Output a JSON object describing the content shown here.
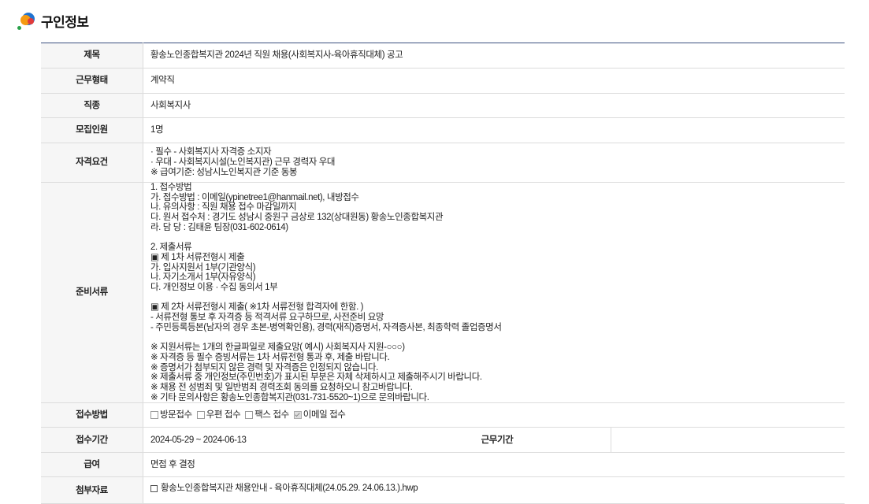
{
  "section": {
    "title": "구인정보"
  },
  "rows": {
    "title": {
      "label": "제목",
      "value": "황송노인종합복지관 2024년 직원 채용(사회복지사-육아휴직대체) 공고"
    },
    "work_type": {
      "label": "근무형태",
      "value": "계약직"
    },
    "job": {
      "label": "직종",
      "value": "사회복지사"
    },
    "headcount": {
      "label": "모집인원",
      "value": "1명"
    },
    "qualification": {
      "label": "자격요건",
      "value": "· 필수 - 사회복지사 자격증 소지자\n· 우대 - 사회복지시설(노인복지관) 근무 경력자 우대\n※ 급여기준: 성남시노인복지관 기준 동봉"
    },
    "documents": {
      "label": "준비서류",
      "value": "1. 접수방법\n가. 접수방법 : 이메일(ypinetree1@hanmail.net), 내방접수\n나. 유의사항 : 직원 채용 접수 마감일까지\n다. 원서 접수처 : 경기도 성남시 중원구 금상로 132(상대원동) 황송노인종합복지관\n라. 담   당 : 김태윤 팀장(031-602-0614)\n\n2. 제출서류\n▣ 제 1차 서류전형시 제출\n가. 입사지원서 1부(기관양식)\n나. 자기소개서 1부(자유양식)\n다. 개인정보 이용 · 수집 동의서 1부\n\n▣ 제 2차 서류전형시 제출( ※1차 서류전형 합격자에 한함. )\n - 서류전형 통보 후 자격증 등 적격서류 요구하므로, 사전준비 요망\n - 주민등록등본(남자의 경우 초본-병역확인용), 경력(재직)증명서, 자격증사본, 최종학력 졸업증명서\n\n※ 지원서류는 1개의 한글파일로 제출요망( 예시) 사회복지사 지원-○○○)\n※ 자격증 등 필수 증빙서류는 1차 서류전형 통과 후, 제출 바랍니다.\n※ 증명서가 첨부되지 않은 경력 및 자격증은 인정되지 않습니다.\n※ 제출서류 중 개인정보(주민번호)가 표시된 부분은 자체 삭제하시고 제출해주시기 바랍니다.\n※ 채용 전 성범죄 및 일반범죄 경력조회 동의를 요청하오니 참고바랍니다.\n※ 기타 문의사항은 황송노인종합복지관(031-731-5520~1)으로 문의바랍니다."
    },
    "method": {
      "label": "접수방법",
      "options": [
        {
          "label": "방문접수",
          "checked": false
        },
        {
          "label": "우편 접수",
          "checked": false
        },
        {
          "label": "팩스 접수",
          "checked": false
        },
        {
          "label": "이메일 접수",
          "checked": true
        }
      ]
    },
    "period": {
      "label": "접수기간",
      "value": "2024-05-29 ~ 2024-06-13",
      "work_period_label": "근무기간",
      "work_period_value": ""
    },
    "pay": {
      "label": "급여",
      "value": "면접 후 결정"
    },
    "attachment": {
      "label": "첨부자료",
      "file": "황송노인종합복지관 채용안내 - 육아휴직대체(24.05.29.  24.06.13.).hwp"
    }
  }
}
